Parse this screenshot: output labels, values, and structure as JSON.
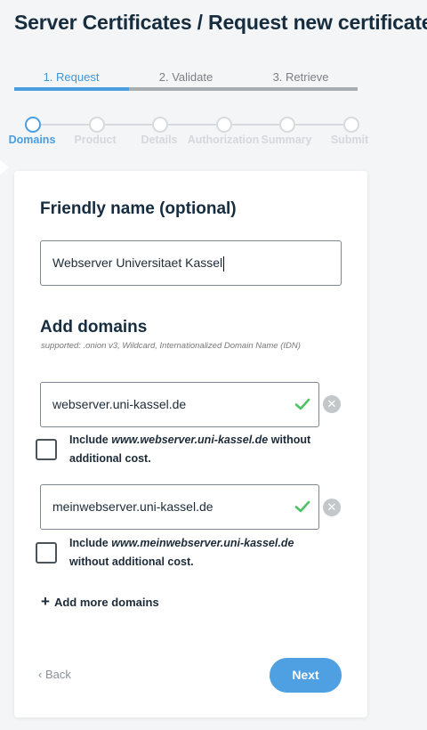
{
  "page": {
    "title": "Server Certificates / Request new certificate"
  },
  "tabs": [
    {
      "label": "1. Request",
      "active": true
    },
    {
      "label": "2. Validate",
      "active": false
    },
    {
      "label": "3. Retrieve",
      "active": false
    }
  ],
  "stepper": [
    {
      "label": "Domains",
      "active": true
    },
    {
      "label": "Product",
      "active": false
    },
    {
      "label": "Details",
      "active": false
    },
    {
      "label": "Authorization",
      "active": false
    },
    {
      "label": "Summary",
      "active": false
    },
    {
      "label": "Submit",
      "active": false
    }
  ],
  "form": {
    "friendly_name_label": "Friendly name (optional)",
    "friendly_name_value": "Webserver Universitaet Kassel",
    "add_domains_label": "Add domains",
    "add_domains_hint": "supported: .onion v3, Wildcard, Internationalized Domain Name (IDN)",
    "domains": [
      {
        "value": "webserver.uni-kassel.de",
        "include_prefix": "Include ",
        "include_domain": "www.webserver.uni-kassel.de",
        "include_suffix": " without additional cost."
      },
      {
        "value": "meinwebserver.uni-kassel.de",
        "include_prefix": "Include ",
        "include_domain": "www.meinwebserver.uni-kassel.de",
        "include_suffix": " without additional cost."
      }
    ],
    "add_more_label": "Add more domains"
  },
  "footer": {
    "back_label": "Back",
    "next_label": "Next"
  },
  "colors": {
    "accent": "#4a9ee0",
    "valid": "#4cc364"
  }
}
